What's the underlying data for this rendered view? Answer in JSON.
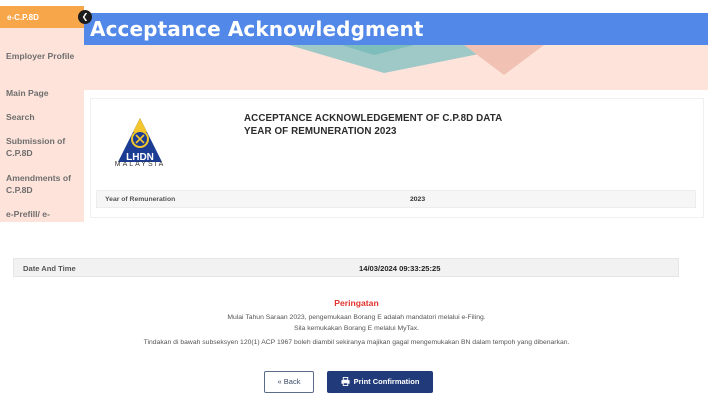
{
  "sidebar": {
    "header": "e-C.P.8D",
    "items": [
      {
        "label": "Employer Profile"
      },
      {
        "label": "Main Page"
      },
      {
        "label": "Search"
      },
      {
        "label": "Submission of C.P.8D"
      },
      {
        "label": "Amendments of C.P.8D"
      },
      {
        "label": "e-Prefill/ e-"
      }
    ]
  },
  "header": {
    "title": "Acceptance Acknowledgment"
  },
  "logo": {
    "text": "LHDN",
    "country": "MALAYSIA"
  },
  "acknowledgement": {
    "title_line1": "ACCEPTANCE ACKNOWLEDGEMENT OF C.P.8D DATA",
    "title_line2": "YEAR OF REMUNERATION 2023"
  },
  "details": {
    "year_label": "Year of Remuneration",
    "year_value": "2023",
    "datetime_label": "Date And Time",
    "datetime_value": "14/03/2024 09:33:25:25"
  },
  "notice": {
    "title": "Peringatan",
    "line1": "Mulai Tahun Saraan 2023, pengemukaan Borang E adalah mandatori melalui e-Filing.",
    "line2": "Sila kemukakan Borang E melalui MyTax.",
    "line3": "Tindakan di bawah subseksyen 120(1) ACP 1967 boleh diambil sekiranya majikan gagal mengemukakan BN dalam tempoh yang dibenarkan."
  },
  "buttons": {
    "back": "« Back",
    "print": "Print Confirmation"
  },
  "colors": {
    "header": "#5288e8",
    "sidebar": "#fde3da",
    "sidebar_header": "#f7a64a",
    "primary_button": "#213b7a",
    "notice_title": "#e0322c"
  }
}
